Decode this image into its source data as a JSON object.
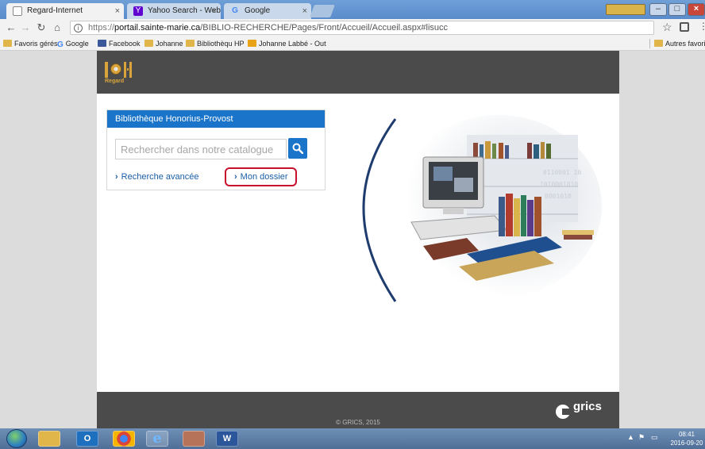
{
  "browser": {
    "tabs": [
      {
        "label": "Regard-Internet",
        "close": "×",
        "active": true
      },
      {
        "label": "Yahoo Search - Web Sea",
        "close": "×",
        "active": false
      },
      {
        "label": "Google",
        "close": "×",
        "active": false
      }
    ],
    "address": {
      "protocol": "https://",
      "domain": "portail.sainte-marie.ca",
      "path": "/BIBLIO-RECHERCHE/Pages/Front/Accueil/Accueil.aspx#lisucc"
    },
    "bookmarks": [
      {
        "label": "Favoris gérés",
        "icon": "folder-icon"
      },
      {
        "label": "Google",
        "icon": "google-icon"
      },
      {
        "label": "Facebook",
        "icon": "facebook-icon"
      },
      {
        "label": "Johanne",
        "icon": "folder-icon"
      },
      {
        "label": "Bibliothèqu HP",
        "icon": "folder-icon"
      },
      {
        "label": "Johanne Labbé - Out",
        "icon": "outlook-icon"
      }
    ],
    "other_bookmarks": "Autres favoris"
  },
  "site": {
    "logo_text": "Regard",
    "panel_title": "Bibliothèque Honorius-Provost",
    "search_placeholder": "Rechercher dans notre catalogue",
    "link_advanced": "Recherche avancée",
    "link_dossier": "Mon dossier",
    "chevron": "›",
    "copyright": "© GRICS, 2015",
    "grics_wordmark": "grics"
  },
  "taskbar": {
    "apps": [
      {
        "label": "",
        "icon": "explorer-folder-icon"
      },
      {
        "label": "O",
        "icon": "outlook-icon"
      },
      {
        "label": "",
        "icon": "chrome-icon"
      },
      {
        "label": "e",
        "icon": "internet-explorer-icon"
      },
      {
        "label": "",
        "icon": "media-icon"
      },
      {
        "label": "W",
        "icon": "word-icon"
      }
    ],
    "time": "08:41",
    "date": "2016-09-20"
  }
}
